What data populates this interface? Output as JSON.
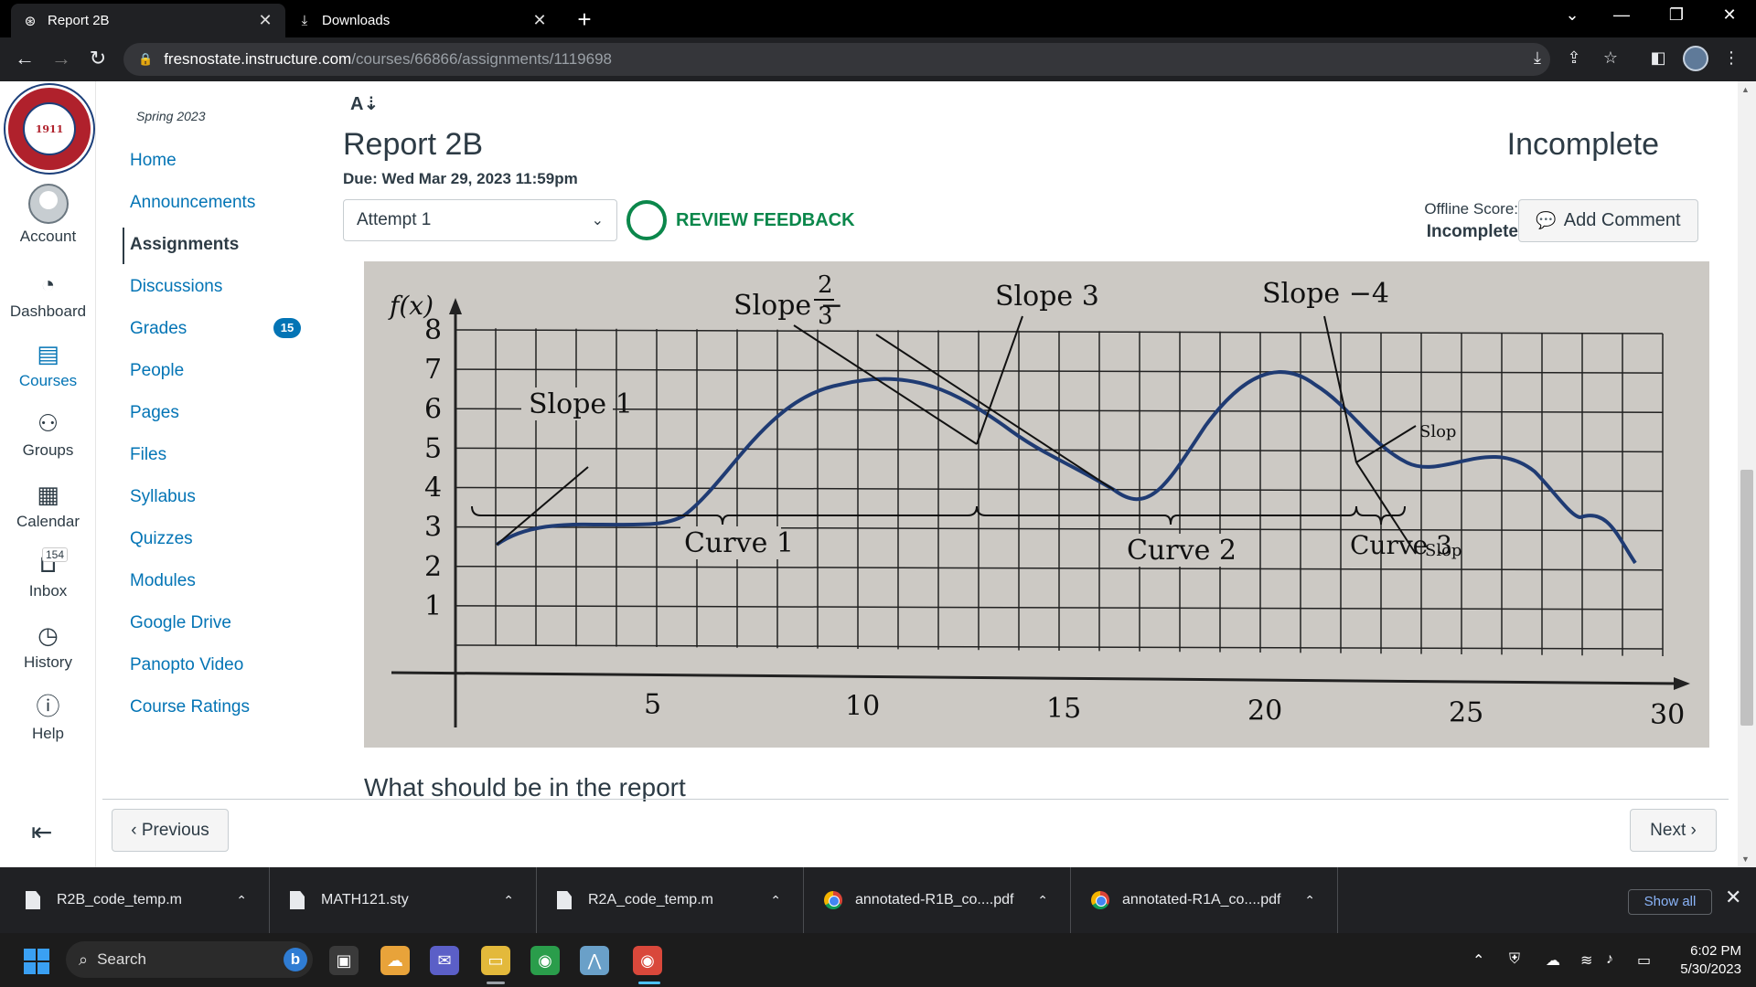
{
  "browser": {
    "tabs": [
      {
        "title": "Report 2B",
        "icon": "canvas-icon",
        "active": true
      },
      {
        "title": "Downloads",
        "icon": "download-icon",
        "active": false
      }
    ],
    "new_tab": "+",
    "url_host": "fresnostate.instructure.com",
    "url_path": "/courses/66866/assignments/1119698"
  },
  "global_nav": {
    "items": [
      {
        "label": "Account",
        "icon": "account-avatar"
      },
      {
        "label": "Dashboard",
        "icon": "dashboard-icon"
      },
      {
        "label": "Courses",
        "icon": "courses-icon",
        "selected": true
      },
      {
        "label": "Groups",
        "icon": "groups-icon"
      },
      {
        "label": "Calendar",
        "icon": "calendar-icon"
      },
      {
        "label": "Inbox",
        "icon": "inbox-icon",
        "badge": "154"
      },
      {
        "label": "History",
        "icon": "history-icon"
      },
      {
        "label": "Help",
        "icon": "help-icon"
      }
    ]
  },
  "course_nav": {
    "term": "Spring 2023",
    "items": [
      {
        "label": "Home"
      },
      {
        "label": "Announcements"
      },
      {
        "label": "Assignments",
        "active": true
      },
      {
        "label": "Discussions"
      },
      {
        "label": "Grades",
        "badge": "15"
      },
      {
        "label": "People"
      },
      {
        "label": "Pages"
      },
      {
        "label": "Files"
      },
      {
        "label": "Syllabus"
      },
      {
        "label": "Quizzes"
      },
      {
        "label": "Modules"
      },
      {
        "label": "Google Drive"
      },
      {
        "label": "Panopto Video"
      },
      {
        "label": "Course Ratings"
      }
    ]
  },
  "assignment": {
    "title": "Report 2B",
    "status": "Incomplete",
    "due": "Due: Wed Mar 29, 2023 11:59pm",
    "attempt": "Attempt 1",
    "review_feedback": "REVIEW FEEDBACK",
    "offline_score_label": "Offline Score:",
    "offline_score_value": "Incomplete",
    "add_comment": "Add Comment",
    "section_heading": "What should be in the report"
  },
  "figure": {
    "y_label": "f(x)",
    "y_ticks": [
      "1",
      "2",
      "3",
      "4",
      "5",
      "6",
      "7",
      "8"
    ],
    "x_ticks": [
      "5",
      "10",
      "15",
      "20",
      "25",
      "30"
    ],
    "labels": {
      "slope1": "Slope 1",
      "slope_neg": "Slope −",
      "frac_num": "2",
      "frac_den": "3",
      "slope3": "Slope 3",
      "slope_neg4": "Slope −4",
      "curve1": "Curve 1",
      "curve2": "Curve 2",
      "curve3": "Curve 3",
      "slope_cut_a": "Slop",
      "slope_cut_b": "Slop"
    },
    "curve_color": "#1f3b73"
  },
  "pager": {
    "previous": "Previous",
    "next": "Next"
  },
  "downloads": {
    "items": [
      {
        "name": "R2B_code_temp.m",
        "type": "file"
      },
      {
        "name": "MATH121.sty",
        "type": "file"
      },
      {
        "name": "R2A_code_temp.m",
        "type": "file"
      },
      {
        "name": "annotated-R1B_co....pdf",
        "type": "chrome"
      },
      {
        "name": "annotated-R1A_co....pdf",
        "type": "chrome"
      }
    ],
    "show_all": "Show all"
  },
  "taskbar": {
    "search": "Search",
    "time": "6:02 PM",
    "date": "5/30/2023"
  }
}
